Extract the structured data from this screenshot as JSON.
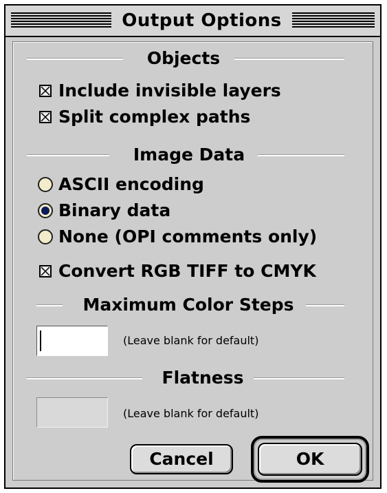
{
  "window": {
    "title": "Output Options"
  },
  "objects": {
    "heading": "Objects",
    "include_invisible_layers": {
      "label": "Include invisible layers",
      "checked": true
    },
    "split_complex_paths": {
      "label": "Split complex paths",
      "checked": true
    }
  },
  "image_data": {
    "heading": "Image Data",
    "options": [
      {
        "label": "ASCII encoding",
        "selected": false
      },
      {
        "label": "Binary data",
        "selected": true
      },
      {
        "label": "None (OPI comments only)",
        "selected": false
      }
    ],
    "convert_rgb_tiff": {
      "label": "Convert RGB TIFF to CMYK",
      "checked": true
    }
  },
  "max_color_steps": {
    "heading": "Maximum Color Steps",
    "value": "",
    "hint": "(Leave blank for default)"
  },
  "flatness": {
    "heading": "Flatness",
    "value": "",
    "hint": "(Leave blank for default)",
    "enabled": false
  },
  "buttons": {
    "cancel": "Cancel",
    "ok": "OK"
  }
}
